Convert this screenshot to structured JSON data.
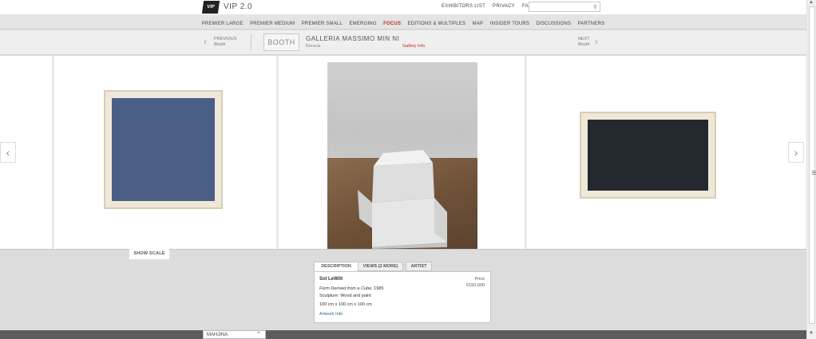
{
  "header": {
    "logo_text": "VIP",
    "brand": "VIP 2.0",
    "links": [
      "EXHIBITORS LIST",
      "PRIVACY",
      "FAQ"
    ],
    "search": {
      "value": "",
      "placeholder": ""
    }
  },
  "nav": {
    "items": [
      "PREMIER LARGE",
      "PREMIER MEDIUM",
      "PREMIER SMALL",
      "EMERGING",
      "FOCUS",
      "EDITIONS & MULTIPLES",
      "MAP",
      "INSIDER TOURS",
      "DISCUSSIONS",
      "PARTNERS"
    ],
    "active": "FOCUS",
    "accent_color": "#c0281f"
  },
  "booth_bar": {
    "previous_label": "PREVIOUS",
    "previous_sub": "Booth",
    "booth_button": "BOOTH",
    "gallery_name": "GALLERIA MASSIMO MIN NI",
    "gallery_city": "Brescia",
    "gallery_info_link": "Gallery Info",
    "next_label": "NEXT",
    "next_sub": "Booth"
  },
  "gallery": {
    "left_arrow": "‹",
    "right_arrow": "›",
    "artworks": [
      {
        "name": "blue-square-painting",
        "color": "#4a5e86"
      },
      {
        "name": "sculpture-photo",
        "color": "#e8e8e8"
      },
      {
        "name": "dark-rectangle-painting",
        "color": "#23282f"
      }
    ]
  },
  "details": {
    "show_scale": "SHOW SCALE",
    "tabs": [
      "DESCRIPTION",
      "VIEWS (2 MORE)",
      "ARTIST"
    ],
    "active_tab": "DESCRIPTION",
    "artist": "Sol LeWitt",
    "title": "Form Derived from a Cube",
    "year": ", 1985",
    "medium": "Sculpture: Wood and paint",
    "dimensions": "100 cm x 100 cm x 100 cm",
    "artwork_info_link": "Artwork Info",
    "price_label": "Price",
    "price_value": "€150,000"
  },
  "footer": {
    "dropdown_value": "MAHJINA",
    "dropdown_caret": "⌃"
  }
}
